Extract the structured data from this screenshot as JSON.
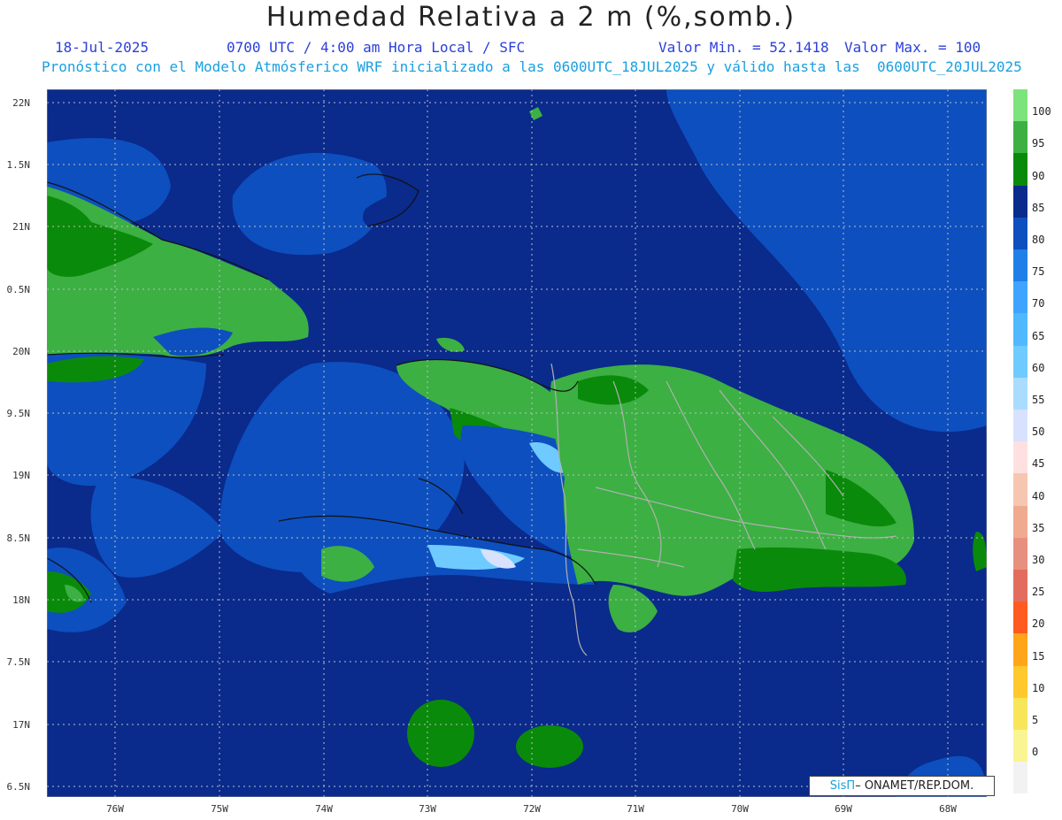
{
  "header": {
    "title": "Humedad Relativa a 2 m (%,somb.)",
    "date": "18-Jul-2025",
    "time": "0700 UTC / 4:00 am Hora Local / SFC",
    "min": "Valor Min. = 52.1418",
    "max": "Valor Max. = 100",
    "subtitle": "Pronóstico con el Modelo Atmósferico WRF inicializado a las 0600UTC_18JUL2025 y válido hasta las  0600UTC_20JUL2025"
  },
  "axes": {
    "y_labels": [
      "22N",
      "1.5N",
      "21N",
      "0.5N",
      "20N",
      "9.5N",
      "19N",
      "8.5N",
      "18N",
      "7.5N",
      "17N",
      "6.5N"
    ],
    "x_labels": [
      "76W",
      "75W",
      "74W",
      "73W",
      "72W",
      "71W",
      "70W",
      "69W",
      "68W"
    ]
  },
  "legend": {
    "labels": [
      "100",
      "95",
      "90",
      "85",
      "80",
      "75",
      "70",
      "65",
      "60",
      "55",
      "50",
      "45",
      "40",
      "35",
      "30",
      "25",
      "20",
      "15",
      "10",
      "5",
      "0"
    ],
    "colors": [
      "#7de37d",
      "#3cb043",
      "#0a8a0a",
      "#0a2a8c",
      "#0d4fbf",
      "#1f7fe8",
      "#3ea4ff",
      "#4fb8ff",
      "#6fcbff",
      "#a9dcff",
      "#d8e2ff",
      "#ffe0e0",
      "#f7c6b0",
      "#f0aa90",
      "#e8907f",
      "#e26d5e",
      "#ff5a1f",
      "#ffa51a",
      "#ffc82d",
      "#f7e65a",
      "#fbf493",
      "#f2f2f2"
    ]
  },
  "credit": {
    "brand": "SisΠ",
    "text": "– ONAMET/REP.DOM."
  }
}
